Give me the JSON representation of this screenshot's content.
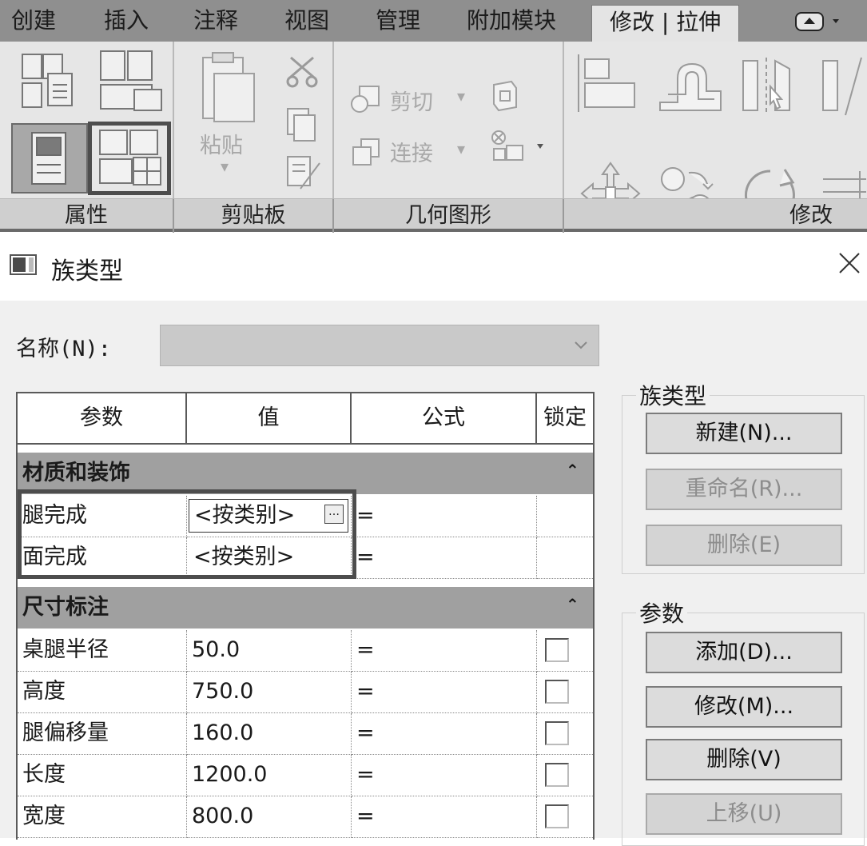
{
  "ribbon": {
    "tabs": [
      "创建",
      "插入",
      "注释",
      "视图",
      "管理",
      "附加模块",
      "修改 | 拉伸"
    ],
    "active_tab": "修改 | 拉伸",
    "groups": {
      "properties": "属性",
      "clipboard": "剪贴板",
      "geometry": "几何图形",
      "modify": "修改"
    },
    "paste_label": "粘贴",
    "cut_label": "剪切",
    "join_label": "连接"
  },
  "dialog": {
    "title": "族类型",
    "name_label": "名称(N):",
    "name_value": "",
    "table": {
      "headers": [
        "参数",
        "值",
        "公式",
        "锁定"
      ],
      "groups": [
        {
          "name": "材质和装饰",
          "rows": [
            {
              "param": "腿完成",
              "value": "<按类别>",
              "formula": "="
            },
            {
              "param": "面完成",
              "value": "<按类别>",
              "formula": "="
            }
          ]
        },
        {
          "name": "尺寸标注",
          "rows": [
            {
              "param": "桌腿半径",
              "value": "50.0",
              "formula": "="
            },
            {
              "param": "高度",
              "value": "750.0",
              "formula": "="
            },
            {
              "param": "腿偏移量",
              "value": "160.0",
              "formula": "="
            },
            {
              "param": "长度",
              "value": "1200.0",
              "formula": "="
            },
            {
              "param": "宽度",
              "value": "800.0",
              "formula": "="
            }
          ]
        }
      ]
    },
    "family_types_group": {
      "title": "族类型",
      "buttons": {
        "new": "新建(N)...",
        "rename": "重命名(R)...",
        "delete": "删除(E)"
      }
    },
    "parameters_group": {
      "title": "参数",
      "buttons": {
        "add": "添加(D)...",
        "modify": "修改(M)...",
        "delete": "删除(V)",
        "move_up": "上移(U)"
      }
    }
  }
}
